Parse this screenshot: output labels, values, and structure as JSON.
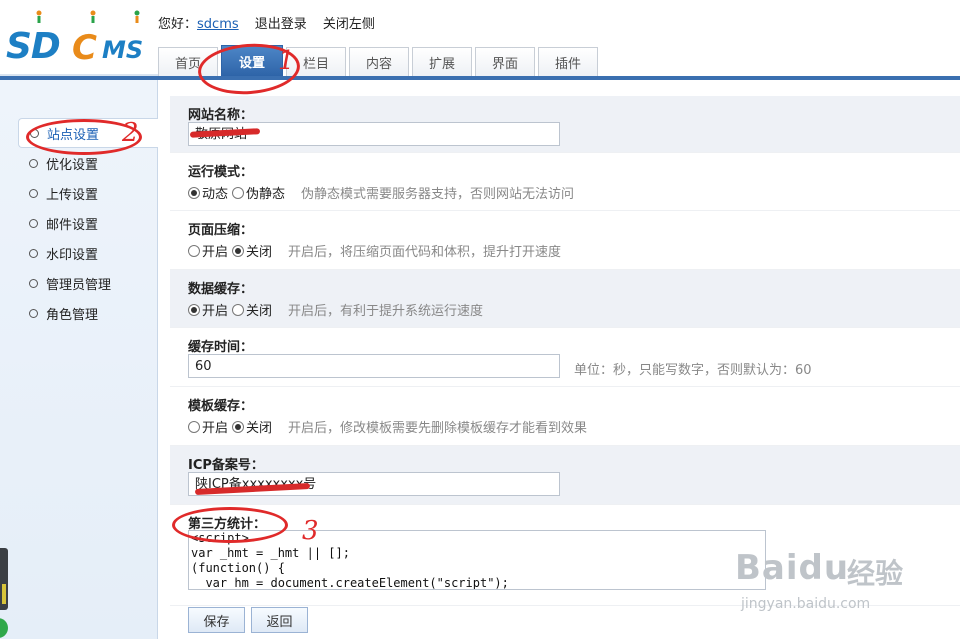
{
  "logo": {
    "part1": "SD",
    "part2": "C",
    "part3": "MS"
  },
  "topbar": {
    "greeting": "您好：",
    "username": "sdcms",
    "logout": "退出登录",
    "close_left": "关闭左侧"
  },
  "tabs": [
    {
      "label": "首页"
    },
    {
      "label": "设置",
      "active": true
    },
    {
      "label": "栏目"
    },
    {
      "label": "内容"
    },
    {
      "label": "扩展"
    },
    {
      "label": "界面"
    },
    {
      "label": "插件"
    }
  ],
  "sidebar": {
    "items": [
      {
        "label": "站点设置",
        "active": true
      },
      {
        "label": "优化设置"
      },
      {
        "label": "上传设置"
      },
      {
        "label": "邮件设置"
      },
      {
        "label": "水印设置"
      },
      {
        "label": "管理员管理"
      },
      {
        "label": "角色管理"
      }
    ]
  },
  "form": {
    "site_name": {
      "label": "网站名称：",
      "value": "敬原网站"
    },
    "run_mode": {
      "label": "运行模式：",
      "opt1": "动态",
      "opt2": "伪静态",
      "selected": "动态",
      "hint": "伪静态模式需要服务器支持，否则网站无法访问"
    },
    "page_compress": {
      "label": "页面压缩：",
      "opt1": "开启",
      "opt2": "关闭",
      "selected": "关闭",
      "hint": "开启后，将压缩页面代码和体积，提升打开速度"
    },
    "data_cache": {
      "label": "数据缓存：",
      "opt1": "开启",
      "opt2": "关闭",
      "selected": "开启",
      "hint": "开启后，有利于提升系统运行速度"
    },
    "cache_time": {
      "label": "缓存时间：",
      "value": "60",
      "hint": "单位：秒，只能写数字，否则默认为：60"
    },
    "tpl_cache": {
      "label": "模板缓存：",
      "opt1": "开启",
      "opt2": "关闭",
      "selected": "关闭",
      "hint": "开启后，修改模板需要先删除模板缓存才能看到效果"
    },
    "icp": {
      "label": "ICP备案号：",
      "value": "陕ICP备xxxxxxxx号"
    },
    "stats": {
      "label": "第三方统计：",
      "value": "<script>\nvar _hmt = _hmt || [];\n(function() {\n  var hm = document.createElement(\"script\");"
    }
  },
  "buttons": {
    "save": "保存",
    "back": "返回"
  },
  "annotations": {
    "n1": "1",
    "n2": "2",
    "n3": "3"
  },
  "watermark": {
    "brand": "Baidu",
    "cn": "经验",
    "url": "jingyan.baidu.com"
  }
}
